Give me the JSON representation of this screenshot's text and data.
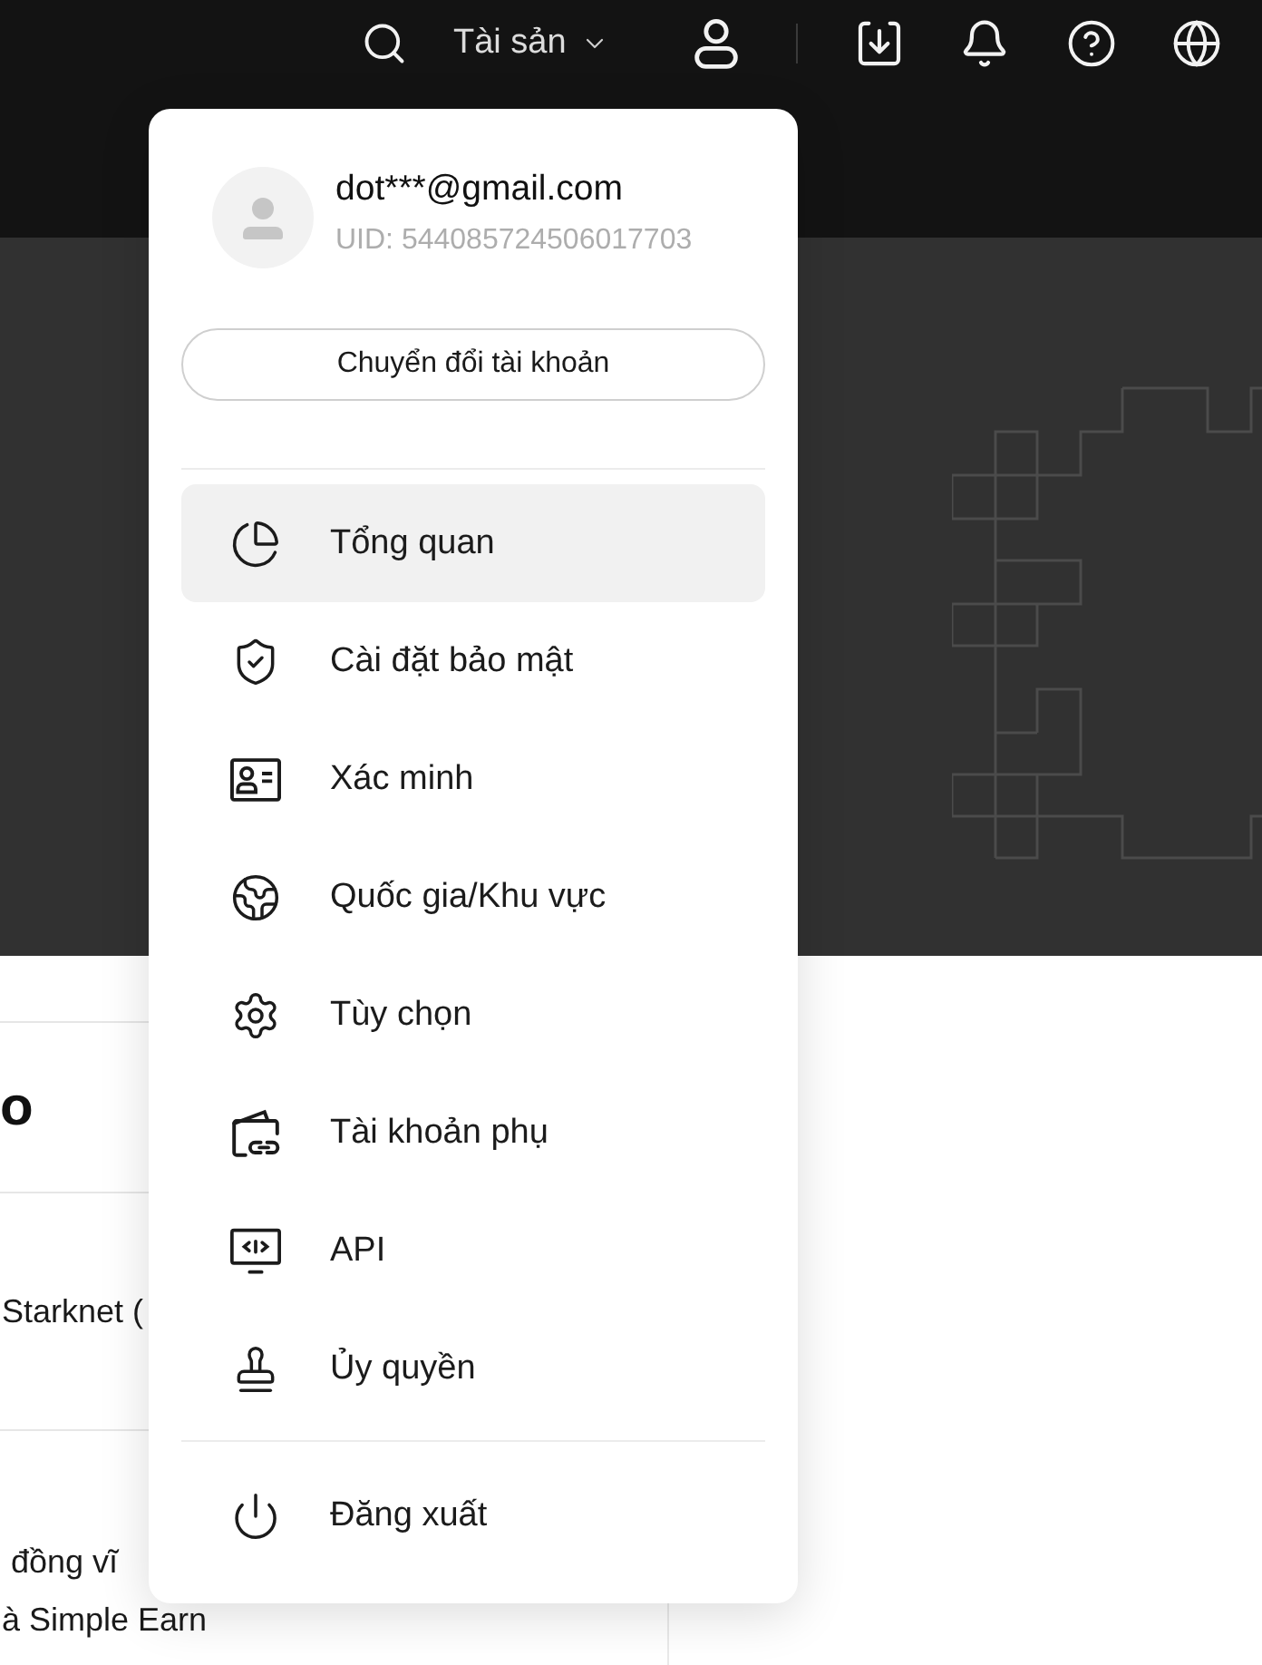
{
  "top_bar": {
    "assets_menu": {
      "label": "Tài sản"
    }
  },
  "account_menu": {
    "email": "dot***@gmail.com",
    "uid": "UID: 544085724506017703",
    "switch_button": "Chuyển đổi tài khoản",
    "items": [
      {
        "label": "Tổng quan",
        "selected": true
      },
      {
        "label": "Cài đặt bảo mật",
        "selected": false
      },
      {
        "label": "Xác minh",
        "selected": false
      },
      {
        "label": "Quốc gia/Khu vực",
        "selected": false
      },
      {
        "label": "Tùy chọn",
        "selected": false
      },
      {
        "label": "Tài khoản phụ",
        "selected": false
      },
      {
        "label": "API",
        "selected": false
      },
      {
        "label": "Ủy quyền",
        "selected": false
      }
    ],
    "logout": {
      "label": "Đăng xuất"
    }
  },
  "page_content": {
    "heading": "o",
    "rows": [
      {
        "lines": [
          "Starknet ("
        ]
      },
      {
        "lines": [
          "đồng vĩ",
          "à Simple Earn"
        ]
      }
    ]
  }
}
